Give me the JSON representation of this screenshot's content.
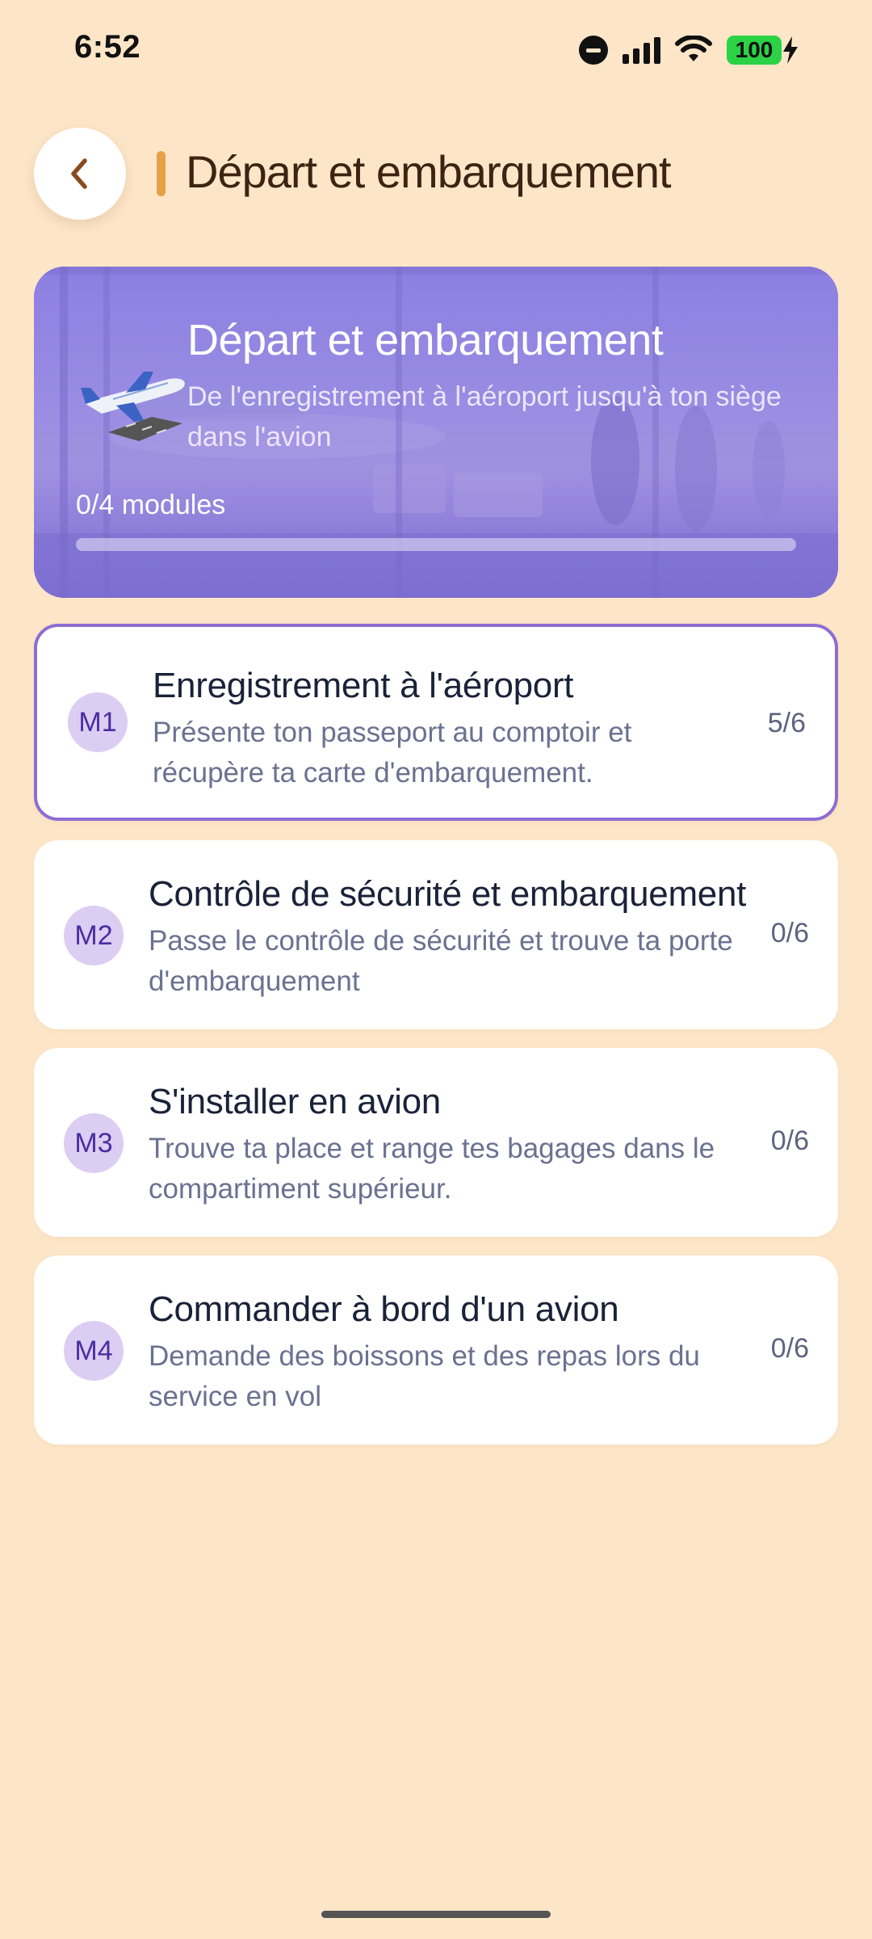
{
  "status_bar": {
    "time": "6:52",
    "battery": "100"
  },
  "header": {
    "title": "Départ et embarquement",
    "back_icon": "chevron-left-icon"
  },
  "hero": {
    "icon": "airplane-icon",
    "title": "Départ et embarquement",
    "subtitle": "De l'enregistrement à l'aéroport jusqu'à ton siège dans l'avion",
    "progress_label": "0/4 modules",
    "progress_fraction": 0
  },
  "modules": [
    {
      "badge": "M1",
      "title": "Enregistrement à l'aéroport",
      "description": "Présente ton passeport au comptoir et récupère ta carte d'embarquement.",
      "progress": "5/6",
      "active": true
    },
    {
      "badge": "M2",
      "title": "Contrôle de sécurité et embarquement",
      "description": "Passe le contrôle de sécurité et trouve ta porte d'embarquement",
      "progress": "0/6",
      "active": false
    },
    {
      "badge": "M3",
      "title": "S'installer en avion",
      "description": "Trouve ta place et range tes bagages dans le compartiment supérieur.",
      "progress": "0/6",
      "active": false
    },
    {
      "badge": "M4",
      "title": "Commander à bord d'un avion",
      "description": "Demande des boissons et des repas lors du service en vol",
      "progress": "0/6",
      "active": false
    }
  ],
  "colors": {
    "background": "#fde6c8",
    "accent": "#e8a048",
    "hero": "#8b7ce0",
    "active_border": "#8e6dd2",
    "badge_bg": "#dccdf2",
    "badge_text": "#4a2ea0"
  }
}
